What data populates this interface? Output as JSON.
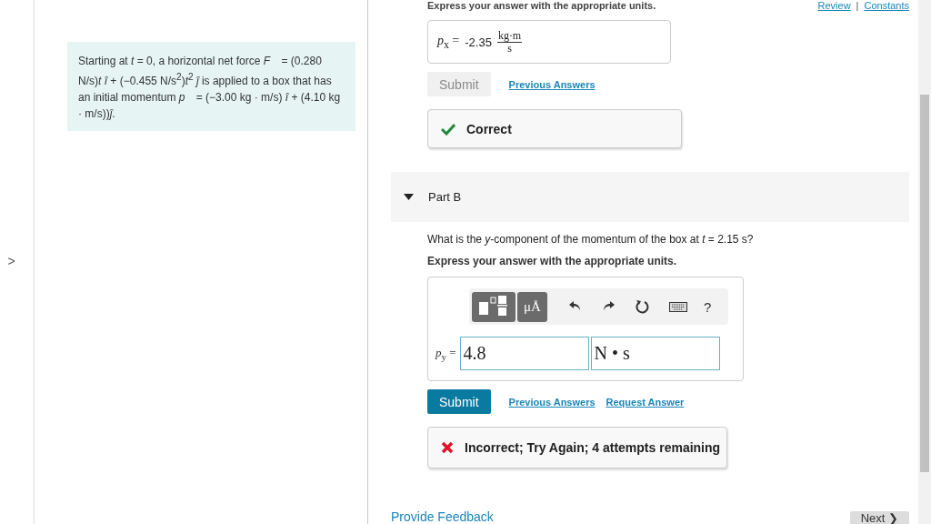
{
  "sidebar": {
    "toggle": ">"
  },
  "problem": {
    "text": "Starting at *t* = 0, a horizontal net force *F⃗* = (0.280 N/s)*t* *î* + (−0.455 N/s$^{2}$)*t*$^{2}$ *ĵ* is applied to a box that has an initial momentum *p⃗* = (−3.00 kg · m/s) *î* + (4.10 kg · m/s))*ĵ*."
  },
  "top_links": [
    "Review",
    "Constants"
  ],
  "top_links_separator": "|",
  "part_a": {
    "instruction": "Express your answer with the appropriate units.",
    "answer": {
      "label": "*p*$_{x}$ =",
      "value": "-2.35",
      "unit_numerator": "kg·m",
      "unit_denominator": "s"
    },
    "submit": {
      "label": "Submit",
      "disabled": true
    },
    "links": [
      "Previous Answers"
    ],
    "feedback": {
      "kind": "correct",
      "text": "Correct"
    }
  },
  "part_b": {
    "title": "Part B",
    "expanded": true,
    "question": "What is the *y*-component of the momentum of the box at *t* = 2.15 s?",
    "instruction": "Express your answer with the appropriate units.",
    "toolbar": {
      "units_button": "μÅ",
      "help": "?"
    },
    "answer": {
      "label": "*p*$_{y}$ =",
      "value": "4.8",
      "unit": "N • s"
    },
    "submit": {
      "label": "Submit",
      "disabled": false
    },
    "links": [
      "Previous Answers",
      "Request Answer"
    ],
    "feedback": {
      "kind": "incorrect",
      "text": "Incorrect; Try Again; 4 attempts remaining"
    }
  },
  "footer": {
    "feedback_link": "Provide Feedback",
    "next": "Next ❯"
  }
}
